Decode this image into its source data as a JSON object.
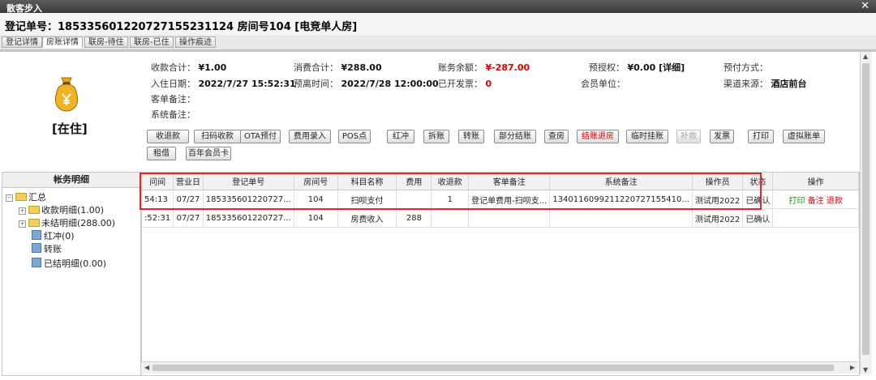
{
  "window": {
    "title": "散客步入",
    "close_icon": "close-icon"
  },
  "header": {
    "title": "登记单号：185335601220727155231124 房间号104 [电竞单人房]"
  },
  "tabs": [
    "登记详情",
    "房账详情",
    "联房-待住",
    "联房-已住",
    "操作痕迹"
  ],
  "summary": {
    "row1": [
      {
        "label": "收款合计：",
        "value": "¥1.00"
      },
      {
        "label": "消费合计：",
        "value": "¥288.00"
      },
      {
        "label": "账务余额：",
        "value": "¥-287.00"
      },
      {
        "label": "预授权：",
        "value": "¥0.00 [详细]"
      },
      {
        "label": "预付方式：",
        "value": ""
      }
    ],
    "row2": [
      {
        "label": "入住日期：",
        "value": "2022/7/27 15:52:31"
      },
      {
        "label": "预离时间：",
        "value": "2022/7/28 12:00:00"
      },
      {
        "label": "已开发票：",
        "value": "0"
      },
      {
        "label": "会员单位：",
        "value": ""
      },
      {
        "label": "渠道来源：",
        "value": "酒店前台"
      }
    ],
    "row3": {
      "label": "客单备注：",
      "value": ""
    },
    "row4": {
      "label": "系统备注：",
      "value": ""
    }
  },
  "guest_status": "[在住]",
  "buttons_row1": [
    "收退款",
    "扫码收款",
    "OTA预付",
    "费用录入",
    "POS点",
    "红冲",
    "拆账",
    "转账",
    "部分结账",
    "查房",
    "结账退房",
    "临时挂账",
    "补救",
    "发票",
    "打印",
    "虚拟账单"
  ],
  "buttons_row2": [
    "租借",
    "百年会员卡"
  ],
  "left_pane": {
    "title": "帐务明细",
    "root": "汇总",
    "items": [
      "收款明细(1.00)",
      "未结明细(288.00)",
      "红冲(0)",
      "转账",
      "已结明细(0.00)"
    ]
  },
  "table": {
    "columns": [
      "时间",
      "营业日",
      "登记单号",
      "房间号",
      "科目名称",
      "费用",
      "收退款",
      "客单备注",
      "系统备注",
      "操作员",
      "状态",
      "操作"
    ],
    "rows": [
      [
        "54:13",
        "07/27",
        "1853356012207​27...",
        "104",
        "扫呗支付",
        "",
        "1",
        "登记单费用-扫呗支...",
        "13401160992112207271554​10...",
        "测试用2022",
        "已确认"
      ],
      [
        ":52:31",
        "07/27",
        "1853356012207​27...",
        "104",
        "房费收入",
        "288",
        "",
        "",
        "",
        "测试用2022",
        "已确认"
      ]
    ],
    "row1_actions": [
      "打印",
      "备注",
      "退款"
    ],
    "header_time_visible": "问间"
  },
  "colors": {
    "highlight": "#e8252a",
    "negative": "#e00000",
    "action_green": "#1f8f1f"
  }
}
